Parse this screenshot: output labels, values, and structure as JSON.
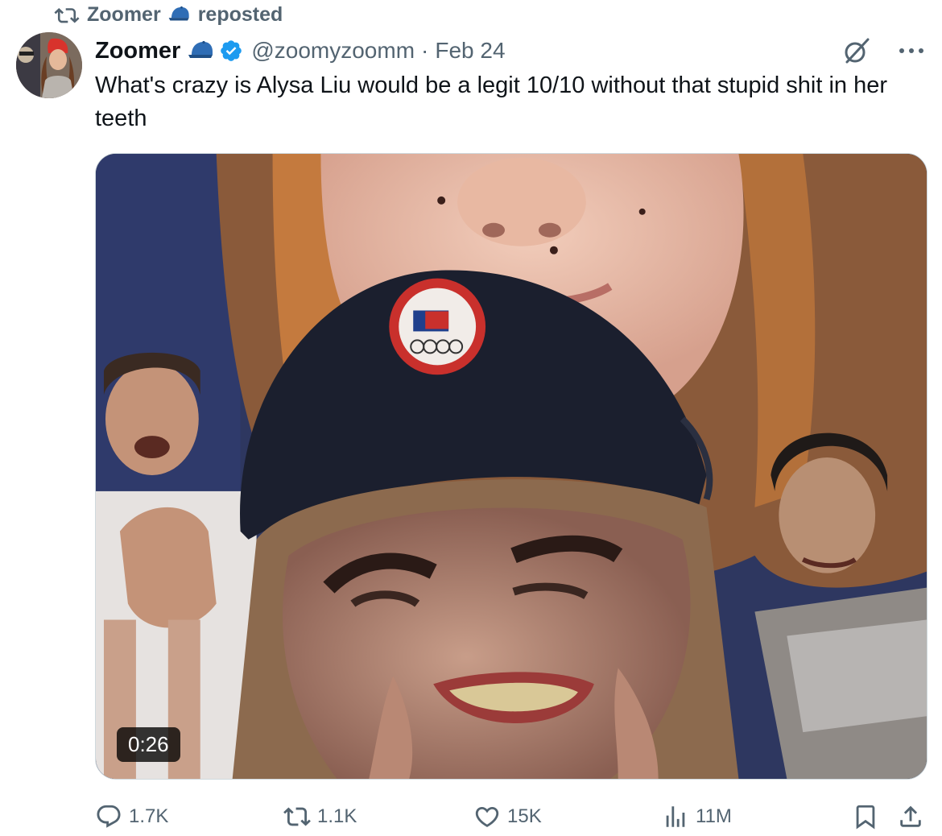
{
  "repost": {
    "reposter": "Zoomer",
    "suffix": "reposted",
    "icon": "repost-icon"
  },
  "tweet": {
    "author": {
      "display_name": "Zoomer",
      "handle": "@zoomyzoomm",
      "verified": true,
      "badge_icon": "baseball-cap-icon"
    },
    "separator": "·",
    "date": "Feb 24",
    "text": "What's crazy is Alysa Liu would be a legit 10/10 without that stupid shit in her teeth",
    "media": {
      "type": "video",
      "duration": "0:26"
    },
    "stats": {
      "replies": "1.7K",
      "reposts": "1.1K",
      "likes": "15K",
      "views": "11M"
    }
  },
  "colors": {
    "text_primary": "#0f1419",
    "text_secondary": "#536471",
    "verified_blue": "#1d9bf0",
    "cap_blue": "#2f6db5"
  }
}
